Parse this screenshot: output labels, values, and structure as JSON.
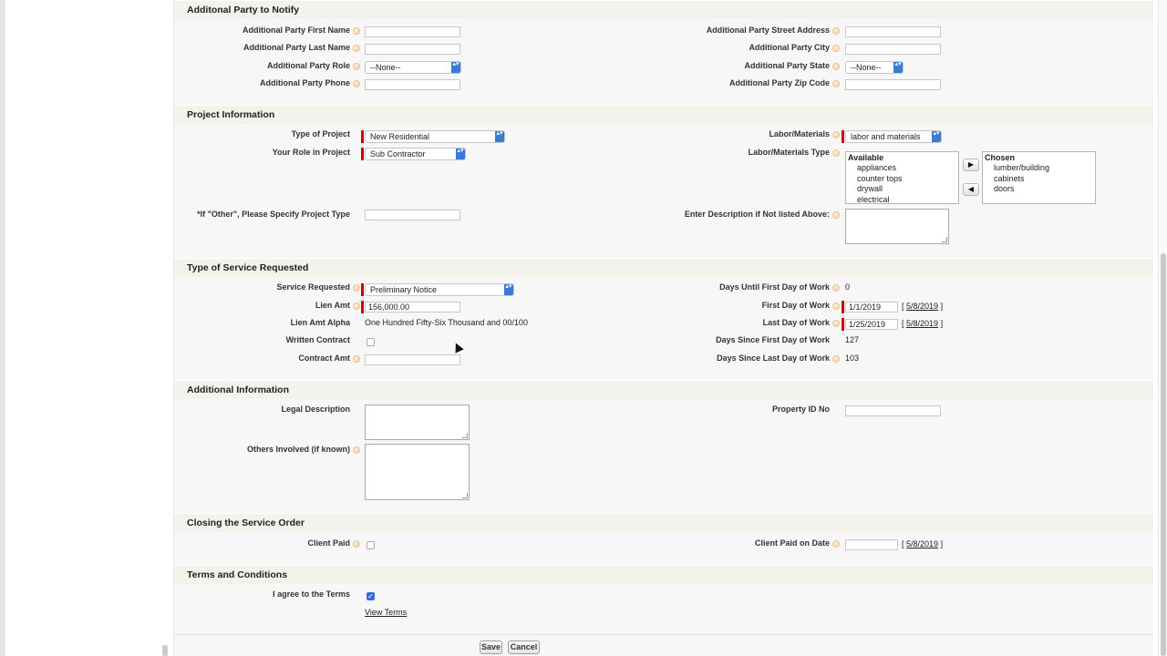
{
  "sections": {
    "additional_party": "Additonal Party to Notify",
    "project": "Project Information",
    "service": "Type of Service Requested",
    "additional_info": "Additional Information",
    "closing": "Closing the Service Order",
    "terms": "Terms and Conditions"
  },
  "additional_party": {
    "first_name_label": "Additional Party First Name",
    "last_name_label": "Additional Party Last Name",
    "role_label": "Additional Party Role",
    "role_value": "--None--",
    "phone_label": "Additional Party Phone",
    "street_label": "Additional Party Street Address",
    "city_label": "Additional Party City",
    "state_label": "Additional Party State",
    "state_value": "--None--",
    "zip_label": "Additional Party Zip Code"
  },
  "project": {
    "type_label": "Type of Project",
    "type_value": "New Residential",
    "role_label": "Your Role in Project",
    "role_value": "Sub Contractor",
    "other_label": "*If \"Other\", Please Specify Project Type",
    "labor_label": "Labor/Materials",
    "labor_value": "labor and materials",
    "labor_type_label": "Labor/Materials Type",
    "available_header": "Available",
    "available": [
      "appliances",
      "counter tops",
      "drywall",
      "electrical"
    ],
    "chosen_header": "Chosen",
    "chosen": [
      "lumber/building",
      "cabinets",
      "doors"
    ],
    "add_arrow": "▶",
    "remove_arrow": "◀",
    "description_label": "Enter Description if Not listed Above:"
  },
  "service": {
    "requested_label": "Service Requested",
    "requested_value": "Preliminary Notice",
    "lien_amt_label": "Lien Amt",
    "lien_amt_value": "156,000.00",
    "lien_alpha_label": "Lien Amt Alpha",
    "lien_alpha_value": "One Hundred Fifty-Six Thousand and 00/100",
    "written_label": "Written Contract",
    "contract_amt_label": "Contract Amt",
    "days_until_label": "Days Until First Day of Work",
    "days_until_value": "0",
    "first_day_label": "First Day of Work",
    "first_day_value": "1/1/2019",
    "first_day_today": "5/8/2019",
    "last_day_label": "Last Day of Work",
    "last_day_value": "1/25/2019",
    "last_day_today": "5/8/2019",
    "since_first_label": "Days Since First Day of Work",
    "since_first_value": "127",
    "since_last_label": "Days Since Last Day of Work",
    "since_last_value": "103"
  },
  "additional_info": {
    "legal_label": "Legal Description",
    "others_label": "Others Involved (if known)",
    "property_label": "Property ID No"
  },
  "closing": {
    "paid_label": "Client Paid",
    "paid_date_label": "Client Paid on Date",
    "paid_date_today": "5/8/2019"
  },
  "terms": {
    "agree_label": "I agree to the Terms",
    "view_link": "View Terms",
    "check": "✓"
  },
  "buttons": {
    "save": "Save",
    "cancel": "Cancel"
  },
  "brackets": {
    "open": "[",
    "close": "]"
  },
  "select_caret": "▴▾"
}
